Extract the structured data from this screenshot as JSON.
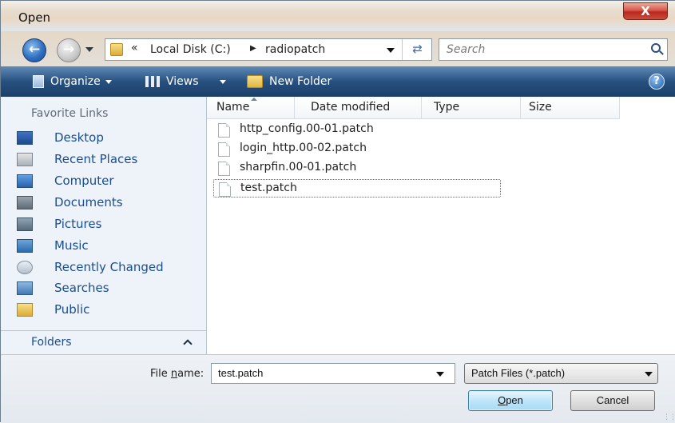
{
  "window": {
    "title": "Open",
    "close_glyph": "X"
  },
  "address": {
    "overflow": "«",
    "crumbs": [
      "Local Disk (C:)",
      "radiopatch"
    ],
    "search_placeholder": "Search"
  },
  "toolbar": {
    "organize": "Organize",
    "views": "Views",
    "new_folder": "New Folder",
    "help_glyph": "?"
  },
  "nav": {
    "favorites_heading": "Favorite Links",
    "items": [
      {
        "label": "Desktop",
        "icon": "desktop-icon"
      },
      {
        "label": "Recent Places",
        "icon": "recent-places-icon"
      },
      {
        "label": "Computer",
        "icon": "computer-icon"
      },
      {
        "label": "Documents",
        "icon": "documents-icon"
      },
      {
        "label": "Pictures",
        "icon": "pictures-icon"
      },
      {
        "label": "Music",
        "icon": "music-icon"
      },
      {
        "label": "Recently Changed",
        "icon": "recently-changed-icon"
      },
      {
        "label": "Searches",
        "icon": "searches-icon"
      },
      {
        "label": "Public",
        "icon": "public-folder-icon"
      }
    ],
    "folders_label": "Folders"
  },
  "filelist": {
    "columns": [
      "Name",
      "Date modified",
      "Type",
      "Size"
    ],
    "files": [
      {
        "name": "http_config.00-01.patch"
      },
      {
        "name": "login_http.00-02.patch"
      },
      {
        "name": "sharpfin.00-01.patch"
      },
      {
        "name": "test.patch",
        "selected": true
      }
    ]
  },
  "bottom": {
    "filename_label_pre": "File ",
    "filename_label_accel": "n",
    "filename_label_post": "ame:",
    "filename_value": "test.patch",
    "filter_value": "Patch Files (*.patch)",
    "open_accel": "O",
    "open_rest": "pen",
    "cancel_label": "Cancel"
  },
  "colors": {
    "toolbar_bg": "#1b3f69",
    "link_blue": "#1a4d8f",
    "close_red": "#c43b2c",
    "open_button_border": "#3c7fb1"
  }
}
